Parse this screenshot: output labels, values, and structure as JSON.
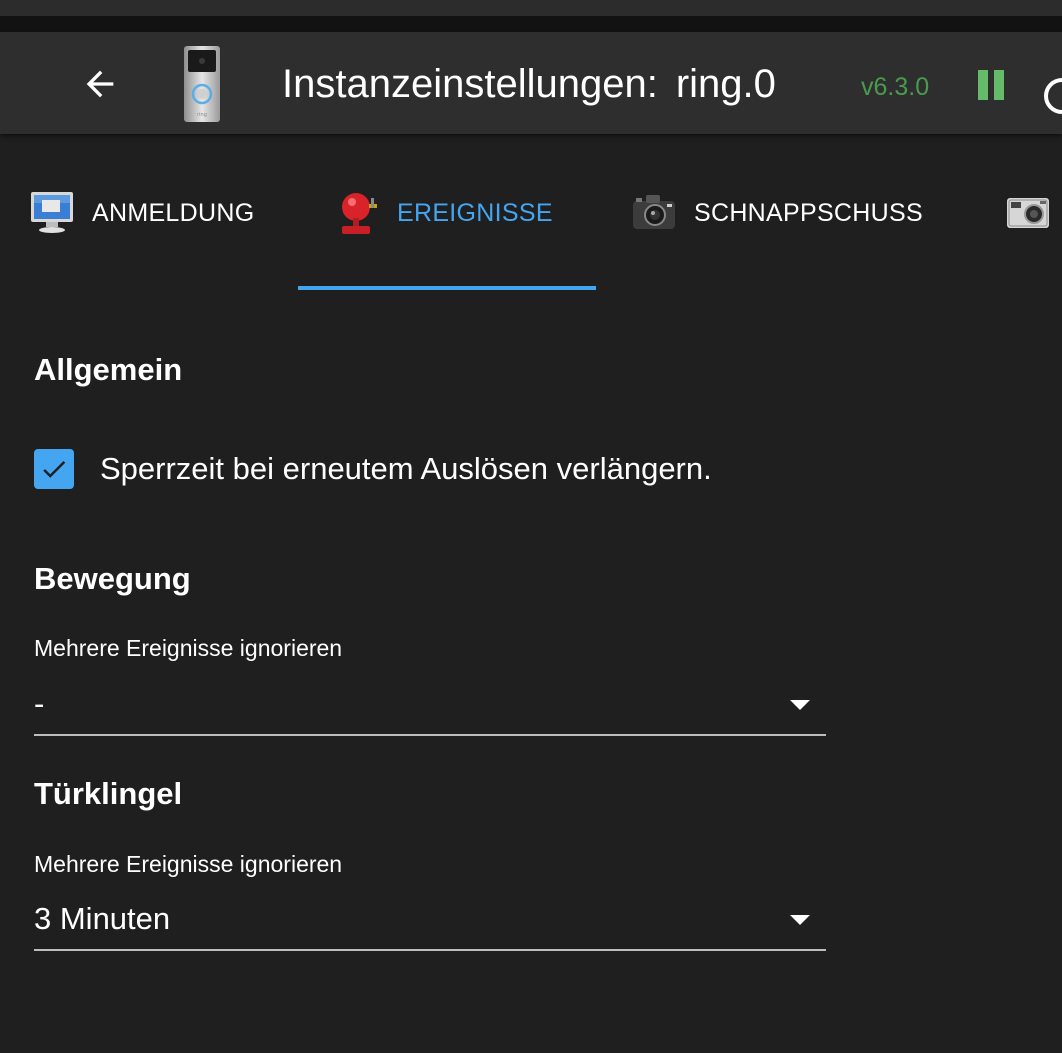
{
  "header": {
    "title_prefix": "Instanzeinstellungen:",
    "instance_name": "ring.0",
    "version": "v6.3.0",
    "version_color": "#4a9a4f",
    "pause_color": "#66bb6a"
  },
  "tabs": [
    {
      "label": "ANMELDUNG",
      "icon": "monitor-icon",
      "active": false
    },
    {
      "label": "EREIGNISSE",
      "icon": "alarm-bell-icon",
      "active": true
    },
    {
      "label": "SCHNAPPSCHUSS",
      "icon": "camera-icon",
      "active": false
    },
    {
      "label": "",
      "icon": "photo-camera-icon",
      "active": false
    }
  ],
  "accent_color": "#44a5f0",
  "sections": {
    "general": {
      "title": "Allgemein",
      "checkbox_label": "Sperrzeit bei erneutem Auslösen verlängern.",
      "checkbox_checked": true
    },
    "motion": {
      "title": "Bewegung",
      "field_label": "Mehrere Ereignisse ignorieren",
      "field_value": "-"
    },
    "doorbell": {
      "title": "Türklingel",
      "field_label": "Mehrere Ereignisse ignorieren",
      "field_value": "3 Minuten"
    }
  }
}
